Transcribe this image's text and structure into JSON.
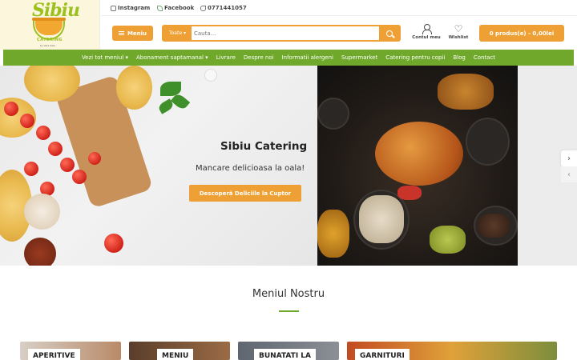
{
  "brand": {
    "logo_text": "Sibiu",
    "logo_sub": "CATERING",
    "logo_by": "by Vera Sala"
  },
  "topbar": {
    "instagram": "Instagram",
    "facebook": "Facebook",
    "phone": "0771441057"
  },
  "header": {
    "menu_label": "Meniu",
    "search_category": "Toate",
    "search_placeholder": "Cauta...",
    "account_label": "Contul meu",
    "wishlist_label": "Wishlist",
    "cart_label": "0 produs(e) - 0,00lei"
  },
  "nav": {
    "items": [
      {
        "label": "Vezi tot meniul ▾"
      },
      {
        "label": "Abonament saptamanal ▾"
      },
      {
        "label": "Livrare"
      },
      {
        "label": "Despre noi"
      },
      {
        "label": "Informatii alergeni"
      },
      {
        "label": "Supermarket"
      },
      {
        "label": "Catering pentru copii"
      },
      {
        "label": "Blog"
      },
      {
        "label": "Contact"
      }
    ]
  },
  "hero": {
    "title": "Sibiu Catering",
    "subtitle": "Mancare delicioasa la oala!",
    "cta": "Descoperă Deliciile la Cuptor",
    "next": "›",
    "prev": "‹"
  },
  "menu_section": {
    "title": "Meniul Nostru",
    "cards": [
      {
        "label": "APERITIVE"
      },
      {
        "label": "MENIU"
      },
      {
        "label": "BUNATATI LA"
      },
      {
        "label": "GARNITURI"
      }
    ]
  },
  "colors": {
    "accent_orange": "#efa035",
    "nav_green": "#6fa82a",
    "logo_green": "#9cc020"
  }
}
